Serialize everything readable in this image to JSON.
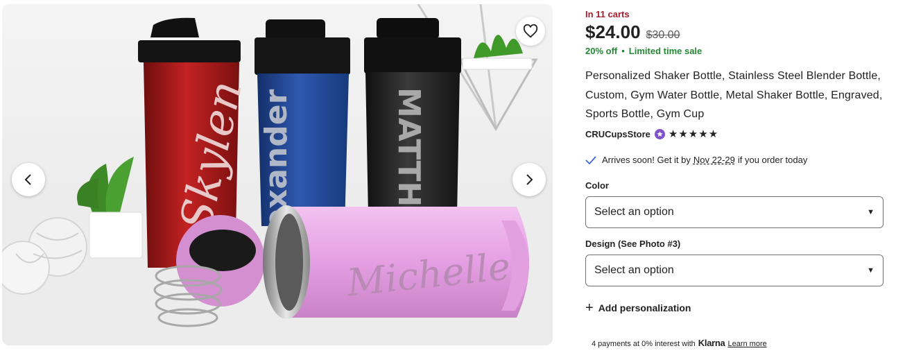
{
  "gallery": {
    "image_names": [
      "Skylen",
      "exander",
      "MATTHE",
      "Michelle"
    ],
    "icons": {
      "prev": "chevron-left-icon",
      "next": "chevron-right-icon",
      "favorite": "heart-icon"
    }
  },
  "listing": {
    "carts_text": "In 11 carts",
    "price": "$24.00",
    "original_price": "$30.00",
    "discount": "20% off",
    "sale_note": "Limited time sale",
    "title": "Personalized Shaker Bottle, Stainless Steel Blender Bottle, Custom, Gym Water Bottle, Metal Shaker Bottle, Engraved, Sports Bottle, Gym Cup",
    "shop_name": "CRUCupsStore",
    "rating_stars": "★★★★★",
    "rating_value": 5
  },
  "delivery": {
    "prefix": "Arrives soon! Get it by",
    "date": "Nov 22-29",
    "suffix": "if you order today"
  },
  "options": {
    "color_label": "Color",
    "color_value": "Select an option",
    "design_label": "Design (See Photo #3)",
    "design_value": "Select an option"
  },
  "personalization": {
    "label": "Add personalization"
  },
  "payments": {
    "text": "4 payments at 0% interest with",
    "brand": "Klarna",
    "link": "Learn more"
  },
  "colors": {
    "sale_green": "#258635",
    "carts_red": "#a61a2e",
    "star_seller_purple": "#7f53c8"
  }
}
